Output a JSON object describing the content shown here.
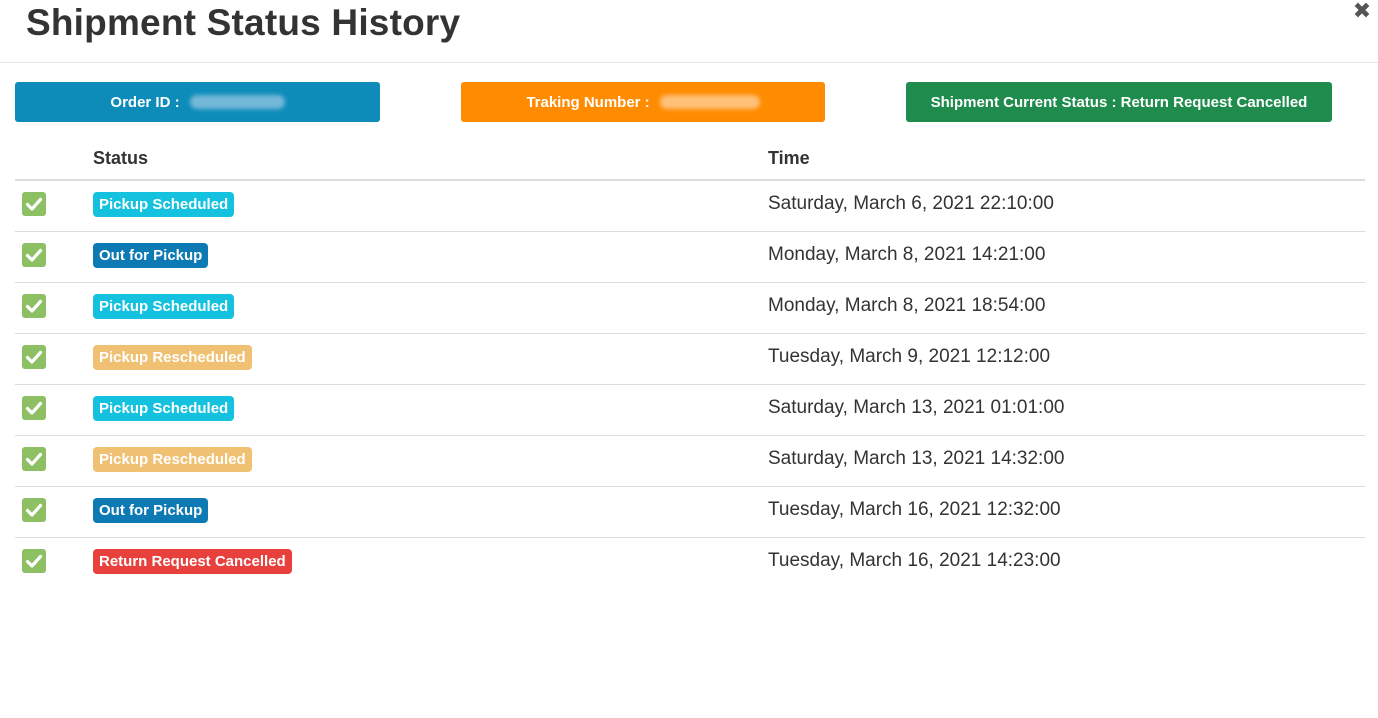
{
  "modal": {
    "title": "Shipment Status History",
    "close_symbol": "✖"
  },
  "info": {
    "order_label": "Order ID :",
    "tracking_label": "Traking Number :",
    "current_status": "Shipment Current Status : Return Request Cancelled",
    "colors": {
      "order": "#0d8cba",
      "tracking": "#ff8c00",
      "status": "#1f8c4d"
    }
  },
  "table": {
    "headers": {
      "status": "Status",
      "time": "Time"
    },
    "rows": [
      {
        "status": "Pickup Scheduled",
        "time": "Saturday, March 6, 2021 22:10:00",
        "color": "#14c1de",
        "icon": "check-square-icon"
      },
      {
        "status": "Out for Pickup",
        "time": "Monday, March 8, 2021 14:21:00",
        "color": "#0e7ab4",
        "icon": "check-square-icon"
      },
      {
        "status": "Pickup Scheduled",
        "time": "Monday, March 8, 2021 18:54:00",
        "color": "#14c1de",
        "icon": "check-square-icon"
      },
      {
        "status": "Pickup Rescheduled",
        "time": "Tuesday, March 9, 2021 12:12:00",
        "color": "#f0c173",
        "icon": "check-square-icon"
      },
      {
        "status": "Pickup Scheduled",
        "time": "Saturday, March 13, 2021 01:01:00",
        "color": "#14c1de",
        "icon": "check-square-icon"
      },
      {
        "status": "Pickup Rescheduled",
        "time": "Saturday, March 13, 2021 14:32:00",
        "color": "#f0c173",
        "icon": "check-square-icon"
      },
      {
        "status": "Out for Pickup",
        "time": "Tuesday, March 16, 2021 12:32:00",
        "color": "#0e7ab4",
        "icon": "check-square-icon"
      },
      {
        "status": "Return Request Cancelled",
        "time": "Tuesday, March 16, 2021 14:23:00",
        "color": "#e8413d",
        "icon": "check-square-icon"
      }
    ]
  }
}
